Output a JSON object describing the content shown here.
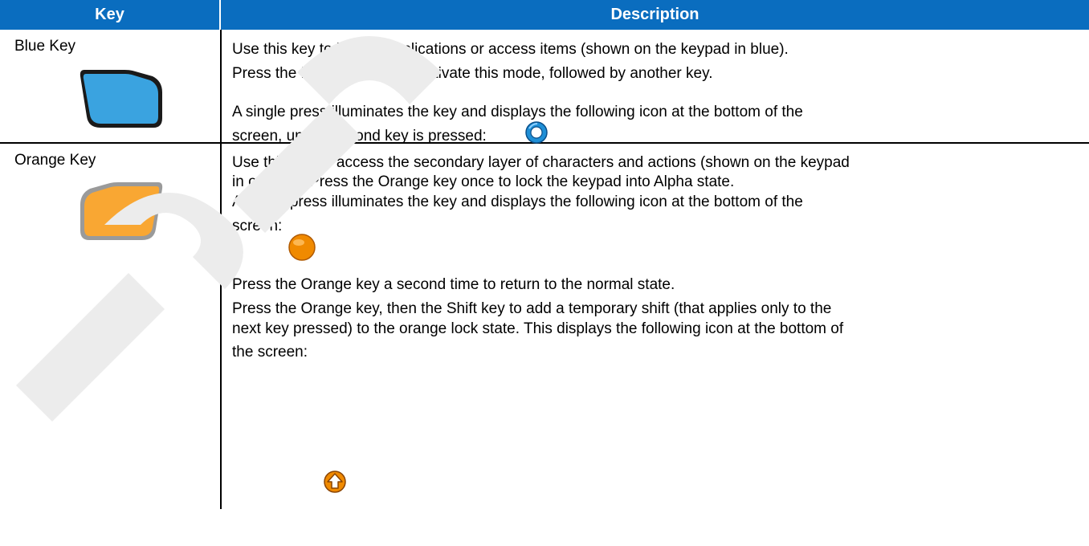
{
  "table": {
    "headers": {
      "key": "Key",
      "description": "Description"
    },
    "rows": [
      {
        "key": "Blue Key",
        "key_icon": "blue-key-icon",
        "lines": [
          "Use this key to launch applications or access items (shown on the keypad in blue).",
          "Press the Blue key once to activate this mode, followed by another key.",
          "A single press illuminates the key and displays the following icon at the bottom of the",
          "screen, until a second key is pressed:"
        ],
        "status_icon": "blue-ring-icon"
      },
      {
        "key": "Orange Key",
        "key_icon": "orange-key-icon",
        "lines": [
          "Use this key to access the secondary layer of characters and actions (shown on the keypad",
          "in orange). Press the Orange key once to lock the keypad into Alpha state.",
          "A single press illuminates the key and displays the following icon at the bottom of the",
          "screen:",
          "Press the Orange key a second time to return to the normal state.",
          "Press the Orange key, then the Shift key to add a temporary shift (that applies only to the",
          "next key pressed) to the orange lock state. This displays the following icon at the bottom of",
          "the screen:"
        ],
        "status_icons": [
          "orange-dot-icon",
          "orange-shift-icon"
        ]
      }
    ]
  },
  "colors": {
    "header_bg": "#0a6dbf",
    "blue_key": "#3aa3e0",
    "orange_key": "#f9a733"
  }
}
